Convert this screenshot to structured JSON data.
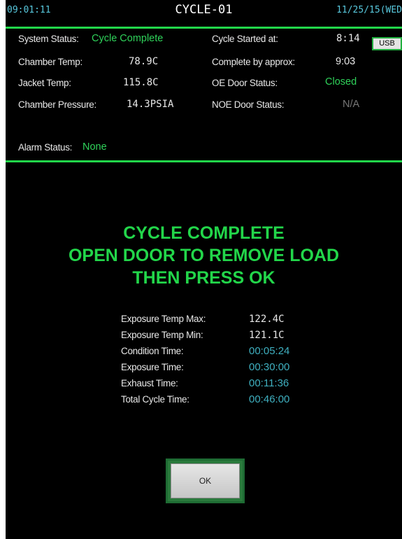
{
  "header": {
    "clock": "09:01:11",
    "title": "CYCLE-01",
    "date": "11/25/15(WED"
  },
  "status": {
    "system_status_label": "System Status:",
    "system_status_value": "Cycle Complete",
    "chamber_temp_label": "Chamber Temp:",
    "chamber_temp_value": "78.9C",
    "jacket_temp_label": "Jacket Temp:",
    "jacket_temp_value": "115.8C",
    "chamber_pressure_label": "Chamber Pressure:",
    "chamber_pressure_value": "14.3PSIA",
    "cycle_started_label": "Cycle Started at:",
    "cycle_started_value": "8:14",
    "complete_by_label": "Complete by approx:",
    "complete_by_value": "9:03",
    "oe_door_label": "OE Door Status:",
    "oe_door_value": "Closed",
    "noe_door_label": "NOE Door Status:",
    "noe_door_value": "N/A",
    "alarm_label": "Alarm Status:",
    "alarm_value": "None",
    "usb_label": "USB"
  },
  "message": {
    "line1": "CYCLE COMPLETE",
    "line2": "OPEN DOOR TO REMOVE LOAD",
    "line3": "THEN PRESS OK"
  },
  "summary": [
    {
      "label": "Exposure Temp Max:",
      "value": "122.4C"
    },
    {
      "label": "Exposure Temp Min:",
      "value": "121.1C"
    },
    {
      "label": "Condition Time:",
      "value": "00:05:24"
    },
    {
      "label": "Exposure Time:",
      "value": "00:30:00"
    },
    {
      "label": "Exhaust Time:",
      "value": "00:11:36"
    },
    {
      "label": "Total Cycle Time:",
      "value": "00:46:00"
    }
  ],
  "ok_button": {
    "label": "OK"
  },
  "colors": {
    "accent_green": "#22d64a",
    "value_cyan": "#3fb0c0",
    "background": "#000000"
  }
}
